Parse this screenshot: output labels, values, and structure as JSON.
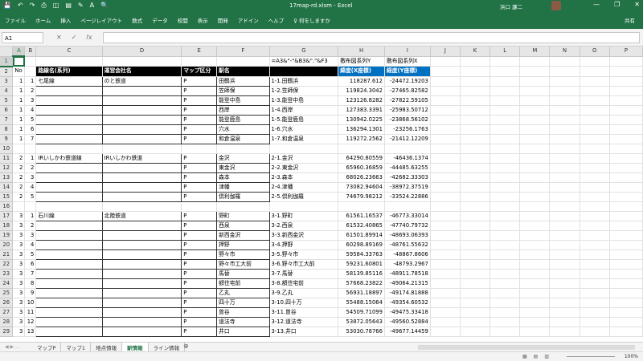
{
  "window": {
    "title": "17map-rd.xlsm  -  Excel",
    "user": "浜口 謙二",
    "qat": [
      "💾",
      "↶",
      "↷",
      "⎙",
      "◫",
      "▤",
      "✎",
      "A",
      "🔍"
    ],
    "controls": [
      "—",
      "❐",
      "✕"
    ]
  },
  "ribbon": {
    "tabs": [
      "ファイル",
      "ホーム",
      "挿入",
      "ページレイアウト",
      "数式",
      "データ",
      "校閲",
      "表示",
      "開発",
      "アドイン",
      "ヘルプ",
      "♀ 何をしますか"
    ],
    "share": "共有"
  },
  "namebox": "A1",
  "formula": "",
  "columns": [
    "A",
    "B",
    "C",
    "D",
    "E",
    "F",
    "G",
    "H",
    "I",
    "J",
    "K",
    "L",
    "M",
    "N",
    "O",
    "P"
  ],
  "rows": [
    {
      "n": "1",
      "cells": {
        "G": "=A3&\"-\"&B3&\".\"&F3",
        "H": "敷布図系列Y",
        "I": "敷布図系列X"
      }
    },
    {
      "n": "2",
      "cells": {
        "A": "No",
        "C": "路線名(系列)",
        "D": "運営会社名",
        "E": "マップ区分",
        "F": "駅名",
        "H": "緯度(X座標)",
        "I": "経度(Y座標)"
      }
    },
    {
      "n": "3",
      "cells": {
        "A": "1",
        "B": "1",
        "C": "七尾線",
        "D": "のと鉄道",
        "E": "P",
        "F": "田鶴浜",
        "G": "1-1.田鶴浜",
        "H": "118287.612",
        "I": "-24472.19203"
      }
    },
    {
      "n": "4",
      "cells": {
        "A": "1",
        "B": "2",
        "E": "P",
        "F": "笠師保",
        "G": "1-2.笠師保",
        "H": "119824.3042",
        "I": "-27465.82582"
      }
    },
    {
      "n": "5",
      "cells": {
        "A": "1",
        "B": "3",
        "E": "P",
        "F": "能登中島",
        "G": "1-3.能登中島",
        "H": "123126.8282",
        "I": "-27822.59105"
      }
    },
    {
      "n": "6",
      "cells": {
        "A": "1",
        "B": "4",
        "E": "P",
        "F": "西岸",
        "G": "1-4.西岸",
        "H": "127383.3391",
        "I": "-25983.50712"
      }
    },
    {
      "n": "7",
      "cells": {
        "A": "1",
        "B": "5",
        "E": "P",
        "F": "能登鹿島",
        "G": "1-5.能登鹿島",
        "H": "130942.0225",
        "I": "-23868.56102"
      }
    },
    {
      "n": "8",
      "cells": {
        "A": "1",
        "B": "6",
        "E": "P",
        "F": "穴水",
        "G": "1-6.穴水",
        "H": "136294.1301",
        "I": "-23256.1763"
      }
    },
    {
      "n": "9",
      "cells": {
        "A": "1",
        "B": "7",
        "E": "P",
        "F": "和倉温泉",
        "G": "1-7.和倉温泉",
        "H": "119272.2562",
        "I": "-21412.12209"
      }
    },
    {
      "n": "10",
      "cells": {}
    },
    {
      "n": "11",
      "cells": {
        "A": "2",
        "B": "1",
        "C": "IRいしかわ鉄道線",
        "D": "IRいしかわ鉄道",
        "E": "P",
        "F": "金沢",
        "G": "2-1.金沢",
        "H": "64290.80559",
        "I": "-46436.1374"
      }
    },
    {
      "n": "12",
      "cells": {
        "A": "2",
        "B": "2",
        "E": "P",
        "F": "東金沢",
        "G": "2-2.東金沢",
        "H": "65960.36859",
        "I": "-44485.63255"
      }
    },
    {
      "n": "13",
      "cells": {
        "A": "2",
        "B": "3",
        "E": "P",
        "F": "森本",
        "G": "2-3.森本",
        "H": "68026.23663",
        "I": "-42682.33303"
      }
    },
    {
      "n": "14",
      "cells": {
        "A": "2",
        "B": "4",
        "E": "P",
        "F": "津幡",
        "G": "2-4.津幡",
        "H": "73082.94604",
        "I": "-38972.37519"
      }
    },
    {
      "n": "15",
      "cells": {
        "A": "2",
        "B": "5",
        "E": "P",
        "F": "倶利伽羅",
        "G": "2-5.倶利伽羅",
        "H": "74679.98212",
        "I": "-33524.22886"
      }
    },
    {
      "n": "16",
      "cells": {}
    },
    {
      "n": "17",
      "cells": {
        "A": "3",
        "B": "1",
        "C": "石川線",
        "D": "北陸鉄道",
        "E": "P",
        "F": "野町",
        "G": "3-1.野町",
        "H": "61561.16537",
        "I": "-46773.33014"
      }
    },
    {
      "n": "18",
      "cells": {
        "A": "3",
        "B": "2",
        "E": "P",
        "F": "西泉",
        "G": "3-2.西泉",
        "H": "61532.40865",
        "I": "-47740.79732"
      }
    },
    {
      "n": "19",
      "cells": {
        "A": "3",
        "B": "3",
        "E": "P",
        "F": "新西金沢",
        "G": "3-3.新西金沢",
        "H": "61501.89914",
        "I": "-48693.06393"
      }
    },
    {
      "n": "20",
      "cells": {
        "A": "3",
        "B": "4",
        "E": "P",
        "F": "押野",
        "G": "3-4.押野",
        "H": "60298.89169",
        "I": "-48761.55632"
      }
    },
    {
      "n": "21",
      "cells": {
        "A": "3",
        "B": "5",
        "E": "P",
        "F": "野々市",
        "G": "3-5.野々市",
        "H": "59584.33763",
        "I": "-48867.8606"
      }
    },
    {
      "n": "22",
      "cells": {
        "A": "3",
        "B": "6",
        "E": "P",
        "F": "野々市工大前",
        "G": "3-6.野々市工大前",
        "H": "59231.60801",
        "I": "-48793.2967"
      }
    },
    {
      "n": "23",
      "cells": {
        "A": "3",
        "B": "7",
        "E": "P",
        "F": "馬替",
        "G": "3-7.馬替",
        "H": "58139.85116",
        "I": "-48911.78518"
      }
    },
    {
      "n": "24",
      "cells": {
        "A": "3",
        "B": "8",
        "E": "P",
        "F": "額住宅前",
        "G": "3-8.額住宅前",
        "H": "57668.23822",
        "I": "-49064.21315"
      }
    },
    {
      "n": "25",
      "cells": {
        "A": "3",
        "B": "9",
        "E": "P",
        "F": "乙丸",
        "G": "3-9.乙丸",
        "H": "56931.18897",
        "I": "-49174.81888"
      }
    },
    {
      "n": "26",
      "cells": {
        "A": "3",
        "B": "10",
        "E": "P",
        "F": "四十万",
        "G": "3-10.四十万",
        "H": "55488.15064",
        "I": "-49354.60532"
      }
    },
    {
      "n": "27",
      "cells": {
        "A": "3",
        "B": "11",
        "E": "P",
        "F": "曽谷",
        "G": "3-11.曽谷",
        "H": "54509.71099",
        "I": "-49475.33418"
      }
    },
    {
      "n": "28",
      "cells": {
        "A": "3",
        "B": "12",
        "E": "P",
        "F": "道法寺",
        "G": "3-12.道法寺",
        "H": "53872.05643",
        "I": "-49560.52884"
      }
    },
    {
      "n": "29",
      "cells": {
        "A": "3",
        "B": "13",
        "E": "P",
        "F": "井口",
        "G": "3-13.井口",
        "H": "53030.78766",
        "I": "-49677.14459"
      }
    }
  ],
  "sheets": [
    "マップP",
    "マップ1",
    "地点情報",
    "駅情報",
    "ライン情報"
  ],
  "active_sheet": "駅情報",
  "zoom": "100%"
}
